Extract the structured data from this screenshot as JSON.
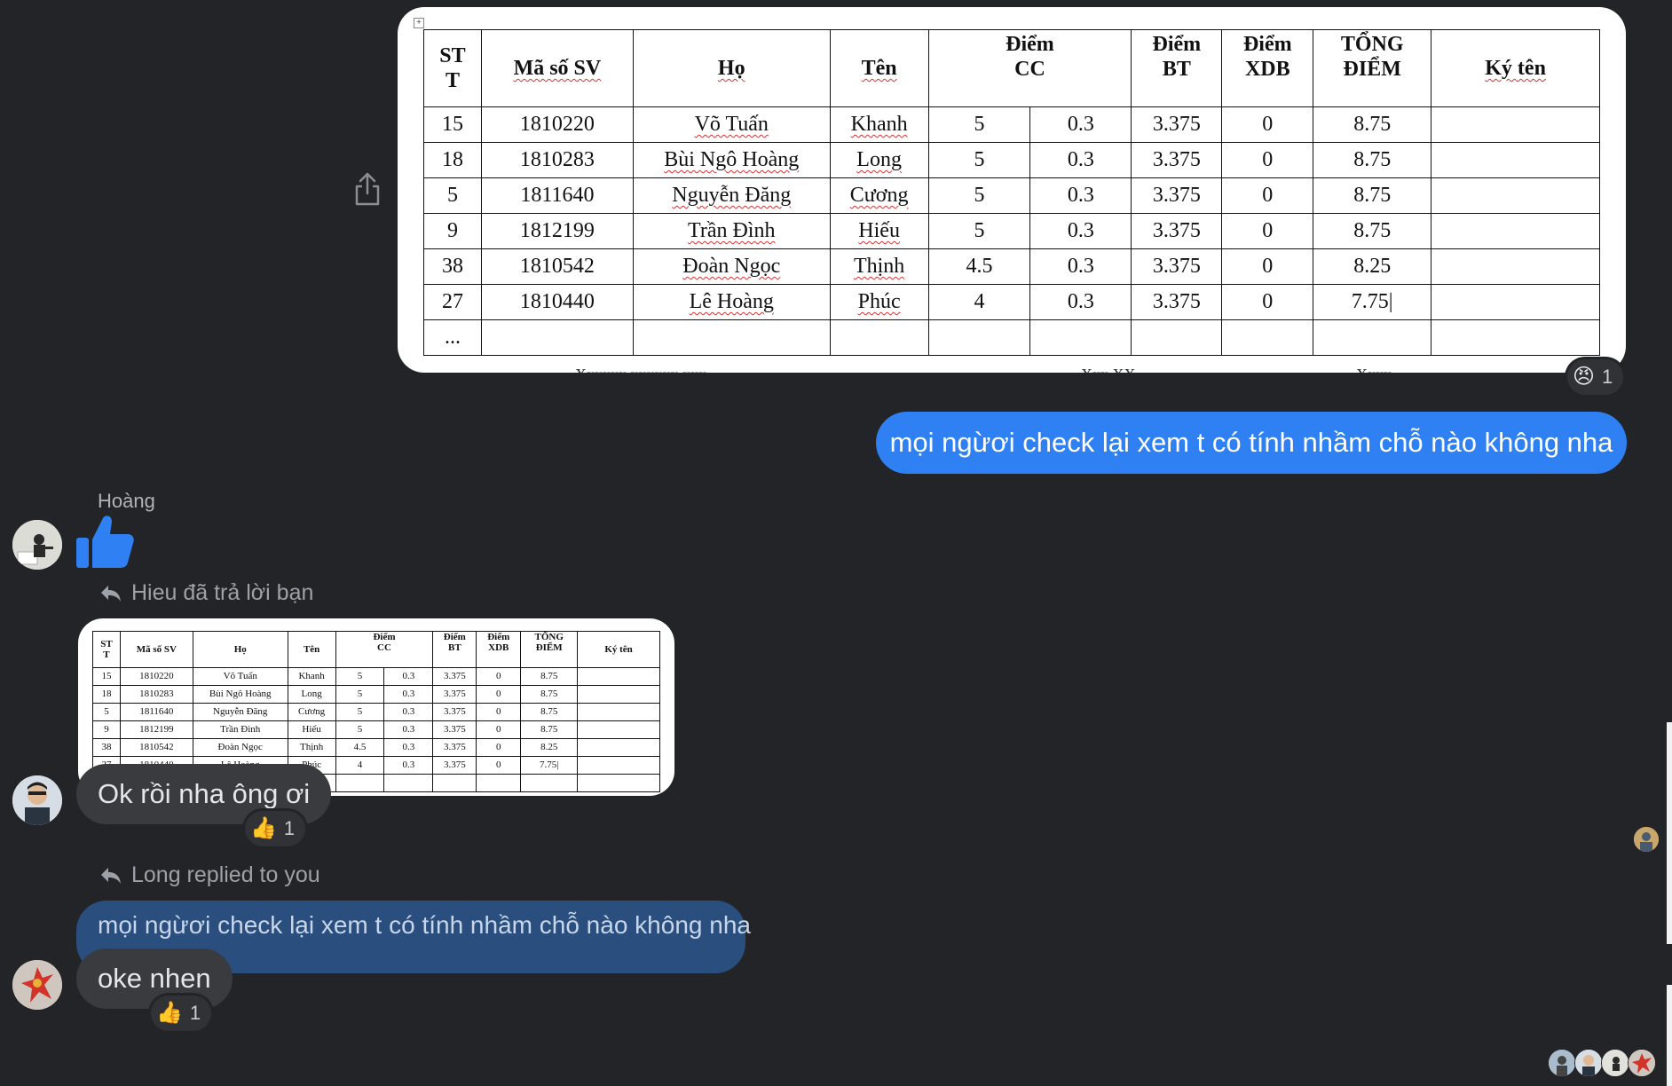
{
  "messages": {
    "table_image": {
      "headers": {
        "stt": "ST\nT",
        "mssv": "Mã số SV",
        "ho": "Họ",
        "ten": "Tên",
        "diem_cc": "Điểm\nCC",
        "diem_bt": "Điểm\nBT",
        "diem_xdb": "Điểm\nXDB",
        "tong_diem": "TỔNG\nĐIỂM",
        "ky_ten": "Ký tên"
      },
      "rows": [
        [
          "15",
          "1810220",
          "Võ Tuấn",
          "Khanh",
          "5",
          "0.3",
          "3.375",
          "0",
          "8.75",
          ""
        ],
        [
          "18",
          "1810283",
          "Bùi Ngô Hoàng",
          "Long",
          "5",
          "0.3",
          "3.375",
          "0",
          "8.75",
          ""
        ],
        [
          "5",
          "1811640",
          "Nguyễn Đăng",
          "Cương",
          "5",
          "0.3",
          "3.375",
          "0",
          "8.75",
          ""
        ],
        [
          "9",
          "1812199",
          "Trần Đình",
          "Hiếu",
          "5",
          "0.3",
          "3.375",
          "0",
          "8.75",
          ""
        ],
        [
          "38",
          "1810542",
          "Đoàn Ngọc",
          "Thịnh",
          "4.5",
          "0.3",
          "3.375",
          "0",
          "8.25",
          ""
        ],
        [
          "27",
          "1810440",
          "Lê Hoàng",
          "Phúc",
          "4",
          "0.3",
          "3.375",
          "0",
          "7.75",
          ""
        ],
        [
          "...",
          "",
          "",
          "",
          "",
          "",
          "",
          "",
          "",
          ""
        ]
      ],
      "reaction": {
        "emoji": "😠",
        "count": "1"
      }
    },
    "my_message": "mọi ngừơi check lại xem t có tính nhầm chỗ nào không nha",
    "hoang": {
      "name": "Hoàng"
    },
    "hieu": {
      "reply_note": "Hieu đã trả lời bạn",
      "text": "Ok rồi nha ông ơi",
      "reaction": {
        "emoji": "👍",
        "count": "1"
      }
    },
    "long": {
      "reply_note": "Long replied to you",
      "quoted_text": "mọi ngừơi check lại xem t có tính nhầm chỗ nào không nha",
      "text": "oke nhen",
      "reaction": {
        "emoji": "👍",
        "count": "1"
      }
    }
  },
  "colors": {
    "background": "#232427",
    "my_bubble": "#2e80f3",
    "like_blue": "#2e80f3"
  }
}
